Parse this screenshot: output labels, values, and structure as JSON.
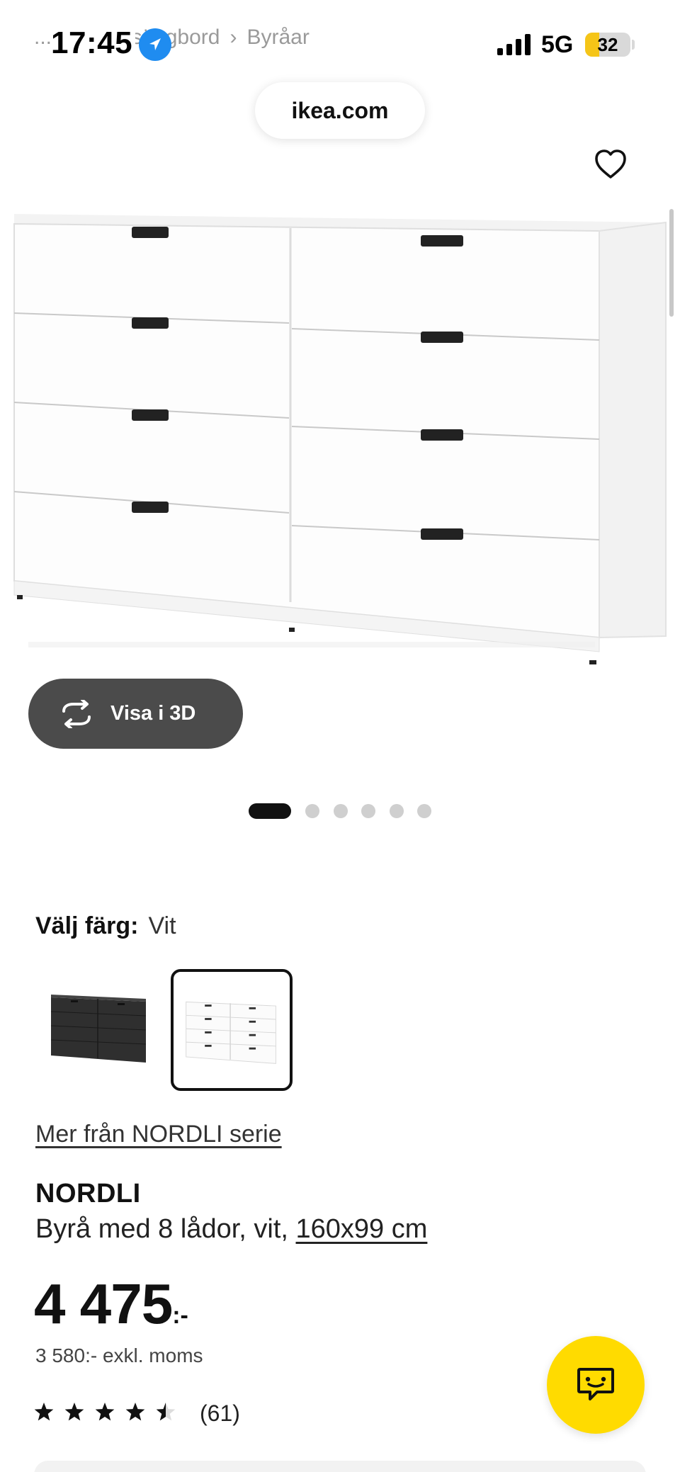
{
  "status_bar": {
    "time": "17:45",
    "network": "5G",
    "battery": "32",
    "battery_level": 0.32
  },
  "breadcrumb": [
    "...",
    "Byrå & sängbord",
    "›",
    "Byråar"
  ],
  "browser": {
    "url": "ikea.com"
  },
  "gallery": {
    "view_3d_label": "Visa i 3D",
    "image_count": 6,
    "active_index": 0
  },
  "color_picker": {
    "label": "Välj färg:",
    "selected": "Vit",
    "options": [
      {
        "name": "svart",
        "hex": "#2b2b2b"
      },
      {
        "name": "Vit",
        "hex": "#ffffff"
      }
    ]
  },
  "product": {
    "series_link": "Mer från NORDLI serie",
    "brand": "NORDLI",
    "description": "Byrå med 8 lådor, vit,",
    "size": "160x99 cm",
    "price": "4 475",
    "price_suffix": ":-",
    "price_excl": "3 580:- exkl. moms",
    "rating_value": 4.5,
    "rating_max": 5,
    "review_count": "(61)"
  },
  "colors": {
    "accent_yellow": "#ffdb00",
    "button_dark": "#4b4b4b",
    "text": "#111111"
  }
}
